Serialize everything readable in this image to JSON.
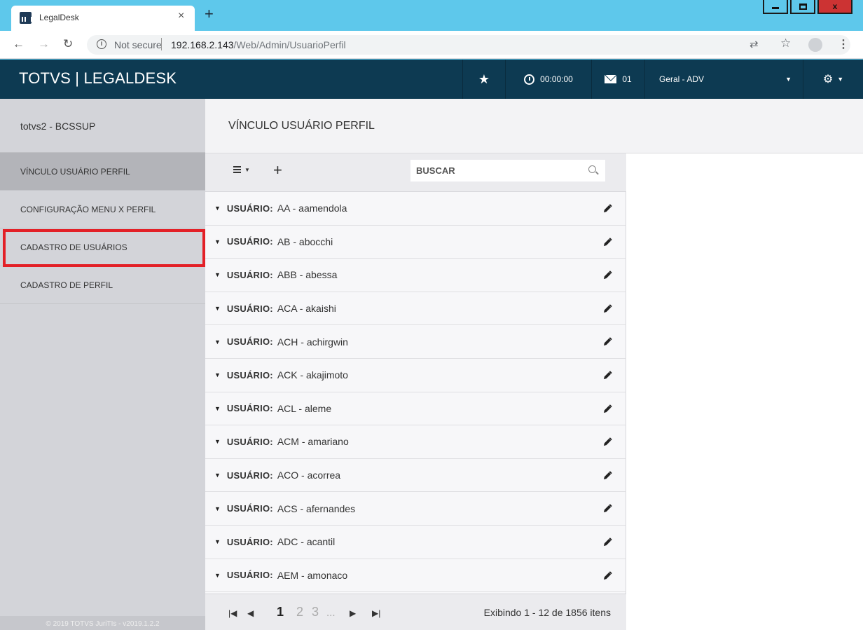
{
  "browser": {
    "tab_title": "LegalDesk",
    "tab_close": "×",
    "new_tab": "+",
    "url_secure_label": "Not secure",
    "url_host": "192.168.2.143",
    "url_path": "/Web/Admin/UsuarioPerfil",
    "window_close": "x"
  },
  "app": {
    "brand": "TOTVS | LEGALDESK",
    "timer": "00:00:00",
    "messages": "01",
    "context": "Geral - ADV"
  },
  "sidebar": {
    "user": "totvs2 - BCSSUP",
    "items": [
      {
        "label": "VÍNCULO USUÁRIO PERFIL",
        "active": true
      },
      {
        "label": "CONFIGURAÇÃO MENU X PERFIL",
        "active": false
      },
      {
        "label": "CADASTRO DE USUÁRIOS",
        "active": false
      },
      {
        "label": "CADASTRO DE PERFIL",
        "active": false
      }
    ],
    "footer": "© 2019 TOTVS JuriTIs - v2019.1.2.2"
  },
  "page": {
    "title": "VÍNCULO USUÁRIO PERFIL",
    "search_placeholder": "BUSCAR"
  },
  "list": {
    "row_label": "USUÁRIO:",
    "rows": [
      "AA - aamendola",
      "AB - abocchi",
      "ABB - abessa",
      "ACA - akaishi",
      "ACH - achirgwin",
      "ACK - akajimoto",
      "ACL - aleme",
      "ACM - amariano",
      "ACO - acorrea",
      "ACS - afernandes",
      "ADC - acantil",
      "AEM - amonaco"
    ]
  },
  "pager": {
    "pages": [
      "1",
      "2",
      "3",
      "..."
    ],
    "info": "Exibindo 1 - 12 de 1856 itens"
  },
  "colors": {
    "topnav": "#0d3a52",
    "sidebar": "#d3d4d9",
    "highlight": "#e32027",
    "browser_frame": "#5ec8eb"
  }
}
